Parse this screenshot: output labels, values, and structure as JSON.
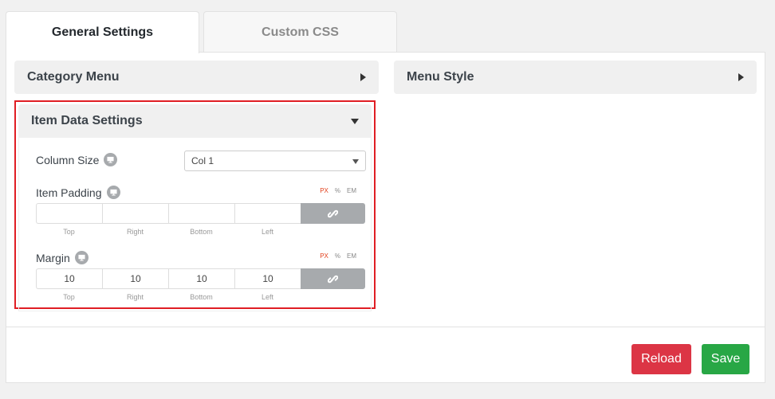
{
  "tabs": [
    {
      "label": "General Settings",
      "active": true
    },
    {
      "label": "Custom CSS",
      "active": false
    }
  ],
  "sections": {
    "category_menu": "Category Menu",
    "menu_style": "Menu Style",
    "item_data_settings": "Item Data Settings"
  },
  "fields": {
    "column_size": {
      "label": "Column Size",
      "value": "Col 1"
    },
    "item_padding": {
      "label": "Item Padding",
      "units": [
        "PX",
        "%",
        "EM"
      ],
      "active_unit": "PX",
      "values": {
        "top": "",
        "right": "",
        "bottom": "",
        "left": ""
      },
      "side_labels": [
        "Top",
        "Right",
        "Bottom",
        "Left"
      ]
    },
    "margin": {
      "label": "Margin",
      "units": [
        "PX",
        "%",
        "EM"
      ],
      "active_unit": "PX",
      "values": {
        "top": "10",
        "right": "10",
        "bottom": "10",
        "left": "10"
      },
      "side_labels": [
        "Top",
        "Right",
        "Bottom",
        "Left"
      ]
    }
  },
  "buttons": {
    "reload": "Reload",
    "save": "Save"
  },
  "colors": {
    "highlight_border": "#e01e24",
    "reload": "#dc3545",
    "save": "#28a745",
    "active_unit": "#e2401c"
  }
}
